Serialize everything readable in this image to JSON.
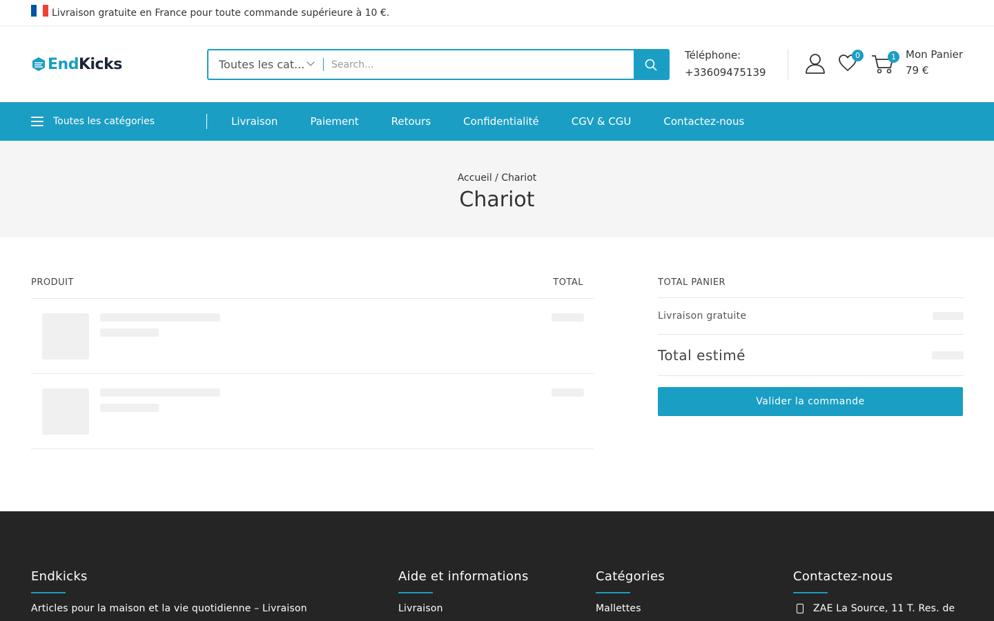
{
  "topbar": {
    "announcement": "Livraison gratuite en France pour toute commande supérieure à 10 €.",
    "flag_colors": [
      "#0055a4",
      "#ffffff",
      "#ef4135"
    ]
  },
  "header": {
    "logo_end": "End",
    "logo_kicks": "Kicks",
    "search": {
      "category_label": "Toutes les cat...",
      "placeholder": "Search..."
    },
    "phone_label": "Téléphone:",
    "phone_number": "+33609475139",
    "wishlist_count": "0",
    "cart_count": "1",
    "cart_label": "Mon Panier",
    "cart_total": "79 €"
  },
  "nav": {
    "all_categories": "Toutes les catégories",
    "links": [
      "Livraison",
      "Paiement",
      "Retours",
      "Confidentialité",
      "CGV & CGU",
      "Contactez-nous"
    ]
  },
  "banner": {
    "breadcrumb": "Accueil / Chariot",
    "title": "Chariot"
  },
  "cart": {
    "col_product": "PRODUIT",
    "col_total": "TOTAL"
  },
  "totals": {
    "heading": "TOTAL PANIER",
    "shipping_label": "Livraison gratuite",
    "estimated_label": "Total estimé",
    "checkout_label": "Valider la commande"
  },
  "footer": {
    "col1_title": "Endkicks",
    "col1_text": "Articles pour la maison et la vie quotidienne – Livraison",
    "col2_title": "Aide et informations",
    "col2_first": "Livraison",
    "col3_title": "Catégories",
    "col3_first": "Mallettes",
    "col4_title": "Contactez-nous",
    "col4_address": "ZAE La Source, 11 T. Res. de"
  },
  "colors": {
    "accent": "#1a9ec4",
    "footer_bg": "#252525"
  }
}
